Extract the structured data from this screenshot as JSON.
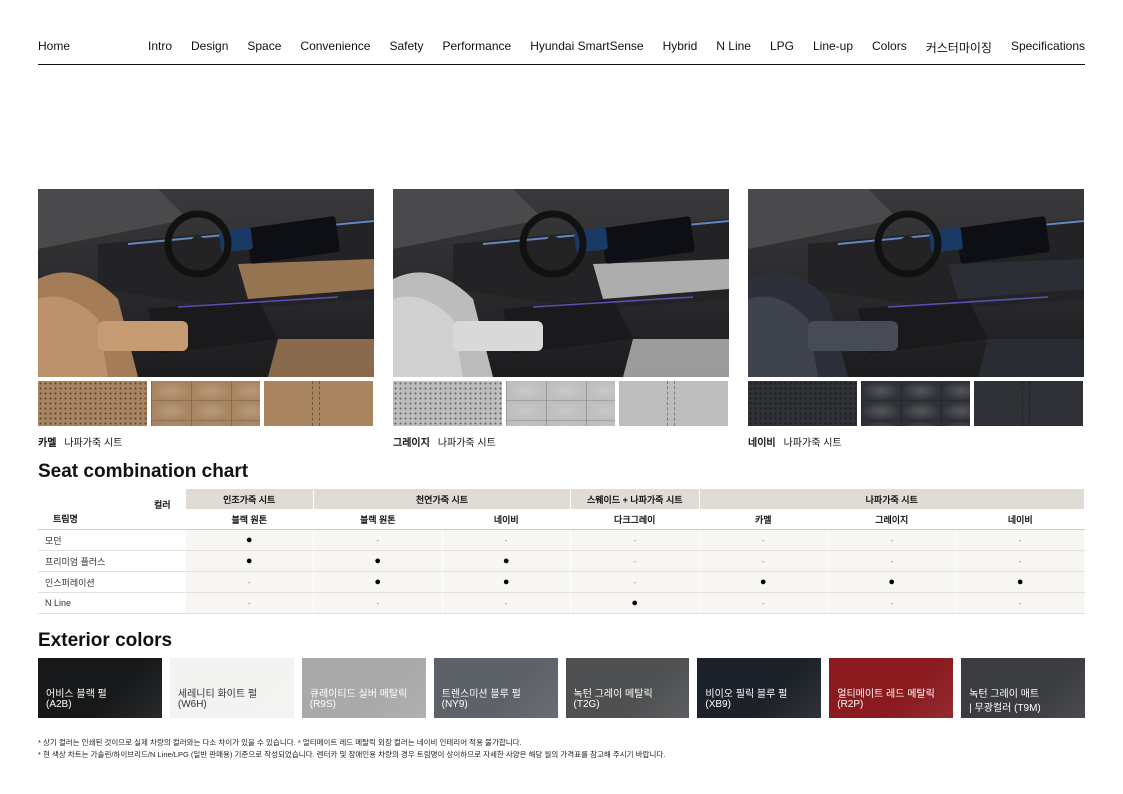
{
  "nav": {
    "home": "Home",
    "items": [
      "Intro",
      "Design",
      "Space",
      "Convenience",
      "Safety",
      "Performance",
      "Hyundai SmartSense",
      "Hybrid",
      "N Line",
      "LPG",
      "Line-up",
      "Colors",
      "커스터마이징",
      "Specifications"
    ]
  },
  "interiors": [
    {
      "name": "카멜",
      "desc": "나파가죽 시트",
      "seat": "#a47d58",
      "seat_light": "#c49b73",
      "swatch": "#a88460"
    },
    {
      "name": "그레이지",
      "desc": "나파가죽 시트",
      "seat": "#bcbcbc",
      "seat_light": "#d9d9d9",
      "swatch": "#bdbdbd"
    },
    {
      "name": "네이비",
      "desc": "나파가죽 시트",
      "seat": "#2d3038",
      "seat_light": "#474b55",
      "swatch": "#2f3137"
    }
  ],
  "seat_chart": {
    "title": "Seat combination chart",
    "corner_color": "컬러",
    "corner_trim": "트림명",
    "groups": [
      {
        "label": "인조가죽 시트",
        "span": 1
      },
      {
        "label": "천연가죽 시트",
        "span": 2
      },
      {
        "label": "스웨이드 + 나파가죽 시트",
        "span": 1
      },
      {
        "label": "나파가죽 시트",
        "span": 3
      }
    ],
    "colors": [
      "블랙 원톤",
      "블랙 원톤",
      "네이비",
      "다크그레이",
      "카멜",
      "그레이지",
      "네이비"
    ],
    "rows": [
      {
        "trim": "모던",
        "cells": [
          "●",
          "-",
          "-",
          "-",
          "-",
          "-",
          "-"
        ]
      },
      {
        "trim": "프리미엄 플러스",
        "cells": [
          "●",
          "●",
          "●",
          "-",
          "-",
          "-",
          "-"
        ]
      },
      {
        "trim": "인스퍼레이션",
        "cells": [
          "-",
          "●",
          "●",
          "-",
          "●",
          "●",
          "●"
        ]
      },
      {
        "trim": "N Line",
        "cells": [
          "-",
          "-",
          "-",
          "●",
          "-",
          "-",
          "-"
        ]
      }
    ]
  },
  "exterior": {
    "title": "Exterior colors",
    "colors": [
      {
        "name": "어비스 블랙 펄",
        "code": "(A2B)",
        "hex": "#16181a"
      },
      {
        "name": "세레니티 화이트 펄",
        "code": "(W6H)",
        "hex": "#f3f3f1"
      },
      {
        "name": "큐레이티드 실버 메탈릭",
        "code": "(R9S)",
        "hex": "#a9a9a9"
      },
      {
        "name": "트렌스미션 블루 펄",
        "code": "(NY9)",
        "hex": "#5d6168"
      },
      {
        "name": "녹턴 그레이 메탈릭",
        "code": "(T2G)",
        "hex": "#4e5052"
      },
      {
        "name": "비이오 필릭 블루 펄",
        "code": "(XB9)",
        "hex": "#1d2129"
      },
      {
        "name": "얼티메이트 레드 메탈릭",
        "code": "(R2P)",
        "hex": "#8a1a1e"
      },
      {
        "name": "녹턴 그레이 매트",
        "code": "| 무광컬러 (T9M)",
        "hex": "#3a3c3f"
      }
    ]
  },
  "notes": [
    "* 상기 컬러는 인쇄된 것이므로 실제 차량의 컬러와는 다소 차이가 있을 수 있습니다.  * 얼티메이트 레드 메탈릭 외장 컬러는 네이비 인테리어 적용 불가합니다.",
    "* 현 색상 차트는 가솔린/하이브리드/N Line/LPG (일반 판매용) 기준으로 작성되었습니다. 렌터카 및 장애인용 차량의 경우 트림명이 상이하므로 자세한 사양은 해당 월의 가격표를 참고해 주시기 바랍니다."
  ]
}
